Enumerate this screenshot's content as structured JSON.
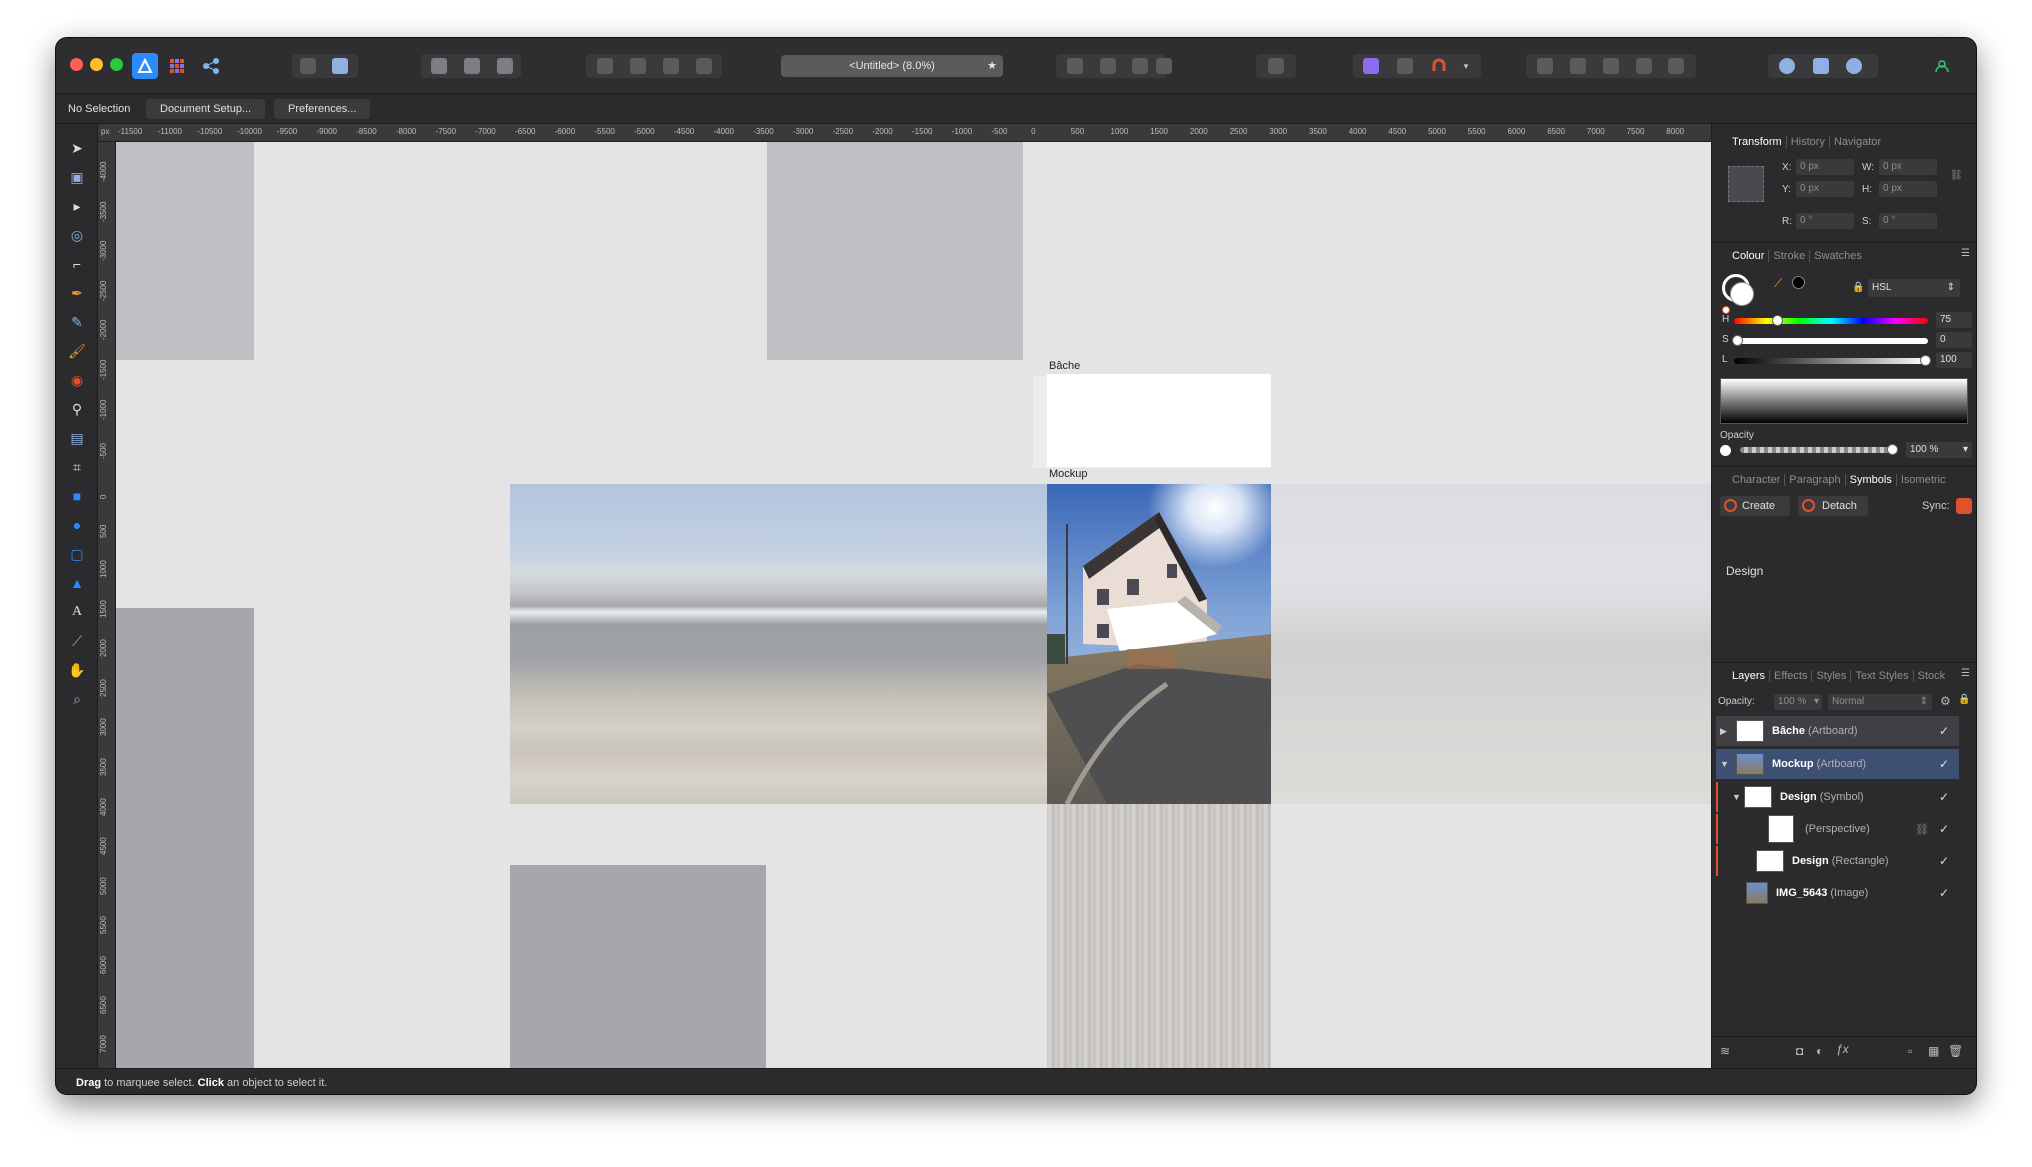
{
  "app": {
    "document_title": "<Untitled> (8.0%)",
    "star": "★"
  },
  "context_bar": {
    "selection_label": "No Selection",
    "document_setup": "Document Setup...",
    "preferences": "Preferences..."
  },
  "ruler": {
    "unit": "px",
    "top_ticks": [
      "-11500",
      "-11000",
      "-10500",
      "-10000",
      "-9500",
      "-9000",
      "-8500",
      "-8000",
      "-7500",
      "-7000",
      "-6500",
      "-6000",
      "-5500",
      "-5000",
      "-4500",
      "-4000",
      "-3500",
      "-3000",
      "-2500",
      "-2000",
      "-1500",
      "-1000",
      "-500",
      "0",
      "500",
      "1000",
      "1500",
      "2000",
      "2500",
      "3000",
      "3500",
      "4000",
      "4500",
      "5000",
      "5500",
      "6000",
      "6500",
      "7000",
      "7500",
      "8000"
    ],
    "left_ticks": [
      "-4000",
      "-3500",
      "-3000",
      "-2500",
      "-2000",
      "-1500",
      "-1000",
      "-500",
      "0",
      "500",
      "1000",
      "1500",
      "2000",
      "2500",
      "3000",
      "3500",
      "4000",
      "4500",
      "5000",
      "5500",
      "6000",
      "6500",
      "7000"
    ]
  },
  "canvas": {
    "artboard_bache_label": "Bâche",
    "artboard_mockup_label": "Mockup"
  },
  "status": {
    "drag": "Drag",
    "drag_text": " to marquee select. ",
    "click": "Click",
    "click_text": " an object to select it."
  },
  "transform_panel": {
    "tabs": [
      "Transform",
      "History",
      "Navigator"
    ],
    "x_label": "X:",
    "x_value": "0 px",
    "y_label": "Y:",
    "y_value": "0 px",
    "w_label": "W:",
    "w_value": "0 px",
    "h_label": "H:",
    "h_value": "0 px",
    "r_label": "R:",
    "r_value": "0 °",
    "s_label": "S:",
    "s_value": "0 °"
  },
  "colour_panel": {
    "tabs": [
      "Colour",
      "Stroke",
      "Swatches"
    ],
    "model": "HSL",
    "h_label": "H",
    "h_value": "75",
    "s_label": "S",
    "s_value": "0",
    "l_label": "L",
    "l_value": "100",
    "opacity_label": "Opacity",
    "opacity_value": "100 %"
  },
  "symbols_panel": {
    "tabs": [
      "Character",
      "Paragraph",
      "Symbols",
      "Isometric"
    ],
    "create": "Create",
    "detach": "Detach",
    "sync": "Sync:",
    "symbol_name": "Design"
  },
  "layers_panel": {
    "tabs": [
      "Layers",
      "Effects",
      "Styles",
      "Text Styles",
      "Stock"
    ],
    "opacity_label": "Opacity:",
    "opacity_value": "100 %",
    "blend_mode": "Normal",
    "layers": [
      {
        "name": "Bâche",
        "type": "(Artboard)"
      },
      {
        "name": "Mockup",
        "type": "(Artboard)"
      },
      {
        "name": "Design",
        "type": "(Symbol)"
      },
      {
        "name": "",
        "type": "(Perspective)"
      },
      {
        "name": "Design",
        "type": "(Rectangle)"
      },
      {
        "name": "IMG_5643",
        "type": "(Image)"
      }
    ]
  },
  "colors": {
    "accent": "#2a8bff",
    "symbol_orange": "#e0522d"
  }
}
